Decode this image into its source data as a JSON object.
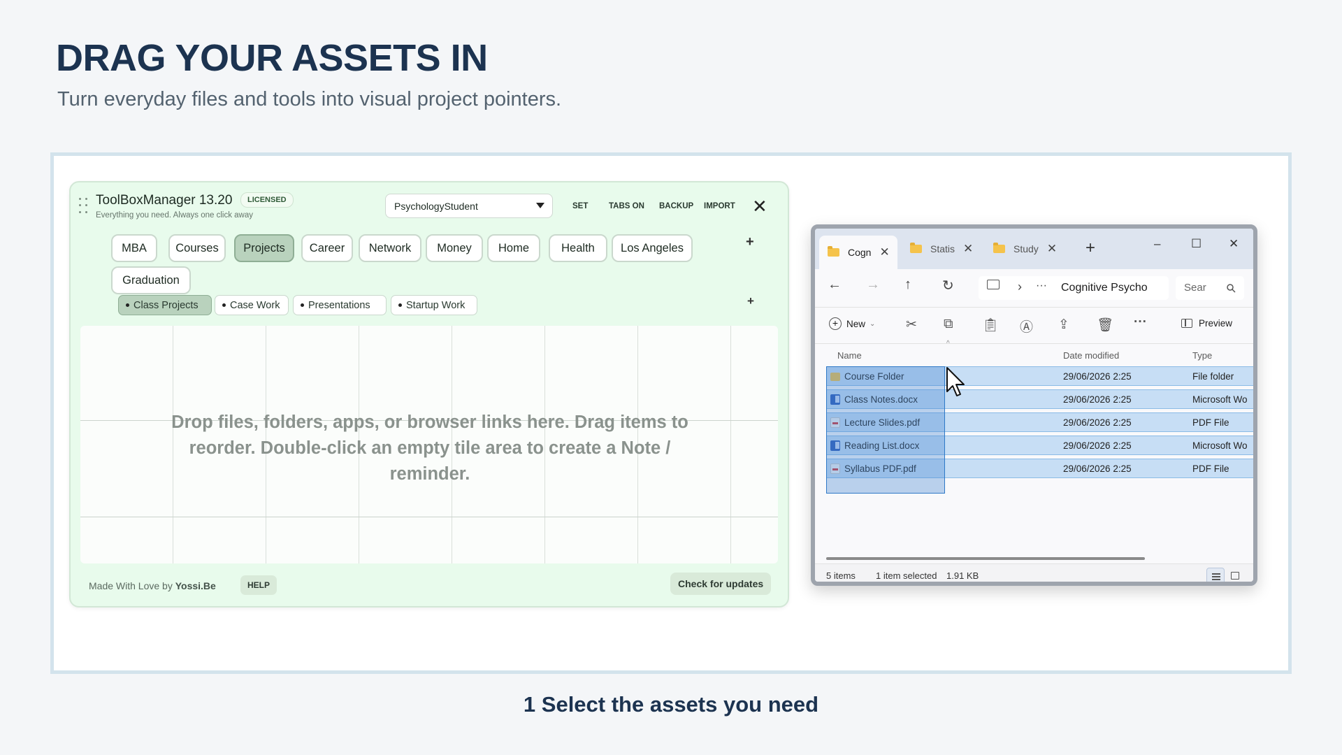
{
  "page": {
    "headline": "DRAG YOUR ASSETS IN",
    "subhead": "Turn everyday files and tools into visual project pointers.",
    "caption": "1  Select the assets you need"
  },
  "toolbox": {
    "app_title": "ToolBoxManager 13.20",
    "license_badge": "LICENSED",
    "tagline": "Everything you need. Always one click away",
    "profile": "PsychologyStudent",
    "actions": [
      "SET",
      "TABS ON",
      "BACKUP",
      "IMPORT"
    ],
    "close": "✕",
    "tabs": [
      {
        "label": "MBA",
        "active": false
      },
      {
        "label": "Courses",
        "active": false
      },
      {
        "label": "Projects",
        "active": true
      },
      {
        "label": "Career",
        "active": false
      },
      {
        "label": "Network",
        "active": false
      },
      {
        "label": "Money",
        "active": false
      },
      {
        "label": "Home",
        "active": false
      },
      {
        "label": "Health",
        "active": false
      },
      {
        "label": "Los Angeles",
        "active": false
      },
      {
        "label": "Graduation",
        "active": false
      }
    ],
    "add": "+",
    "subtabs": [
      {
        "label": "Class Projects",
        "active": true
      },
      {
        "label": "Case Work",
        "active": false
      },
      {
        "label": "Presentations",
        "active": false
      },
      {
        "label": "Startup Work",
        "active": false
      }
    ],
    "drop_hint": "Drop files, folders, apps, or browser links here. Drag items to reorder. Double-click an empty tile area to create a Note / reminder.",
    "footer_prefix": "Made With Love by",
    "footer_author": "Yossi.Be",
    "help": "HELP",
    "check_updates": "Check for updates"
  },
  "explorer": {
    "tabs": [
      {
        "label": "Cogn",
        "active": true
      },
      {
        "label": "Statis",
        "active": false
      },
      {
        "label": "Study",
        "active": false
      }
    ],
    "tab_close": "✕",
    "new_tab": "+",
    "window_controls": {
      "minimize": "–",
      "maximize": "☐",
      "close": "✕"
    },
    "nav": {
      "back": "←",
      "forward": "→",
      "up": "↑",
      "refresh": "↻",
      "more": "···",
      "chevron": "›"
    },
    "address": "Cognitive Psycho",
    "search_placeholder": "Sear",
    "toolbar": {
      "new": "New",
      "preview": "Preview",
      "more": "···"
    },
    "columns": {
      "name": "Name",
      "date": "Date modified",
      "type": "Type"
    },
    "files": [
      {
        "name": "Course Folder",
        "date": "29/06/2026 2:25",
        "type": "File folder",
        "icon": "folder-icon"
      },
      {
        "name": "Class Notes.docx",
        "date": "29/06/2026 2:25",
        "type": "Microsoft Wo",
        "icon": "word-doc-icon"
      },
      {
        "name": "Lecture Slides.pdf",
        "date": "29/06/2026 2:25",
        "type": "PDF File",
        "icon": "pdf-icon"
      },
      {
        "name": "Reading List.docx",
        "date": "29/06/2026 2:25",
        "type": "Microsoft Wo",
        "icon": "word-doc-icon"
      },
      {
        "name": "Syllabus PDF.pdf",
        "date": "29/06/2026 2:25",
        "type": "PDF File",
        "icon": "pdf-icon"
      }
    ],
    "status": {
      "count": "5 items",
      "selected": "1 item selected",
      "size": "1.91 KB"
    }
  },
  "colors": {
    "tbm_bg": "#e8fbec",
    "tab_active": "#b9d2bd",
    "selection": "#c7def5",
    "headline": "#1c3350"
  }
}
